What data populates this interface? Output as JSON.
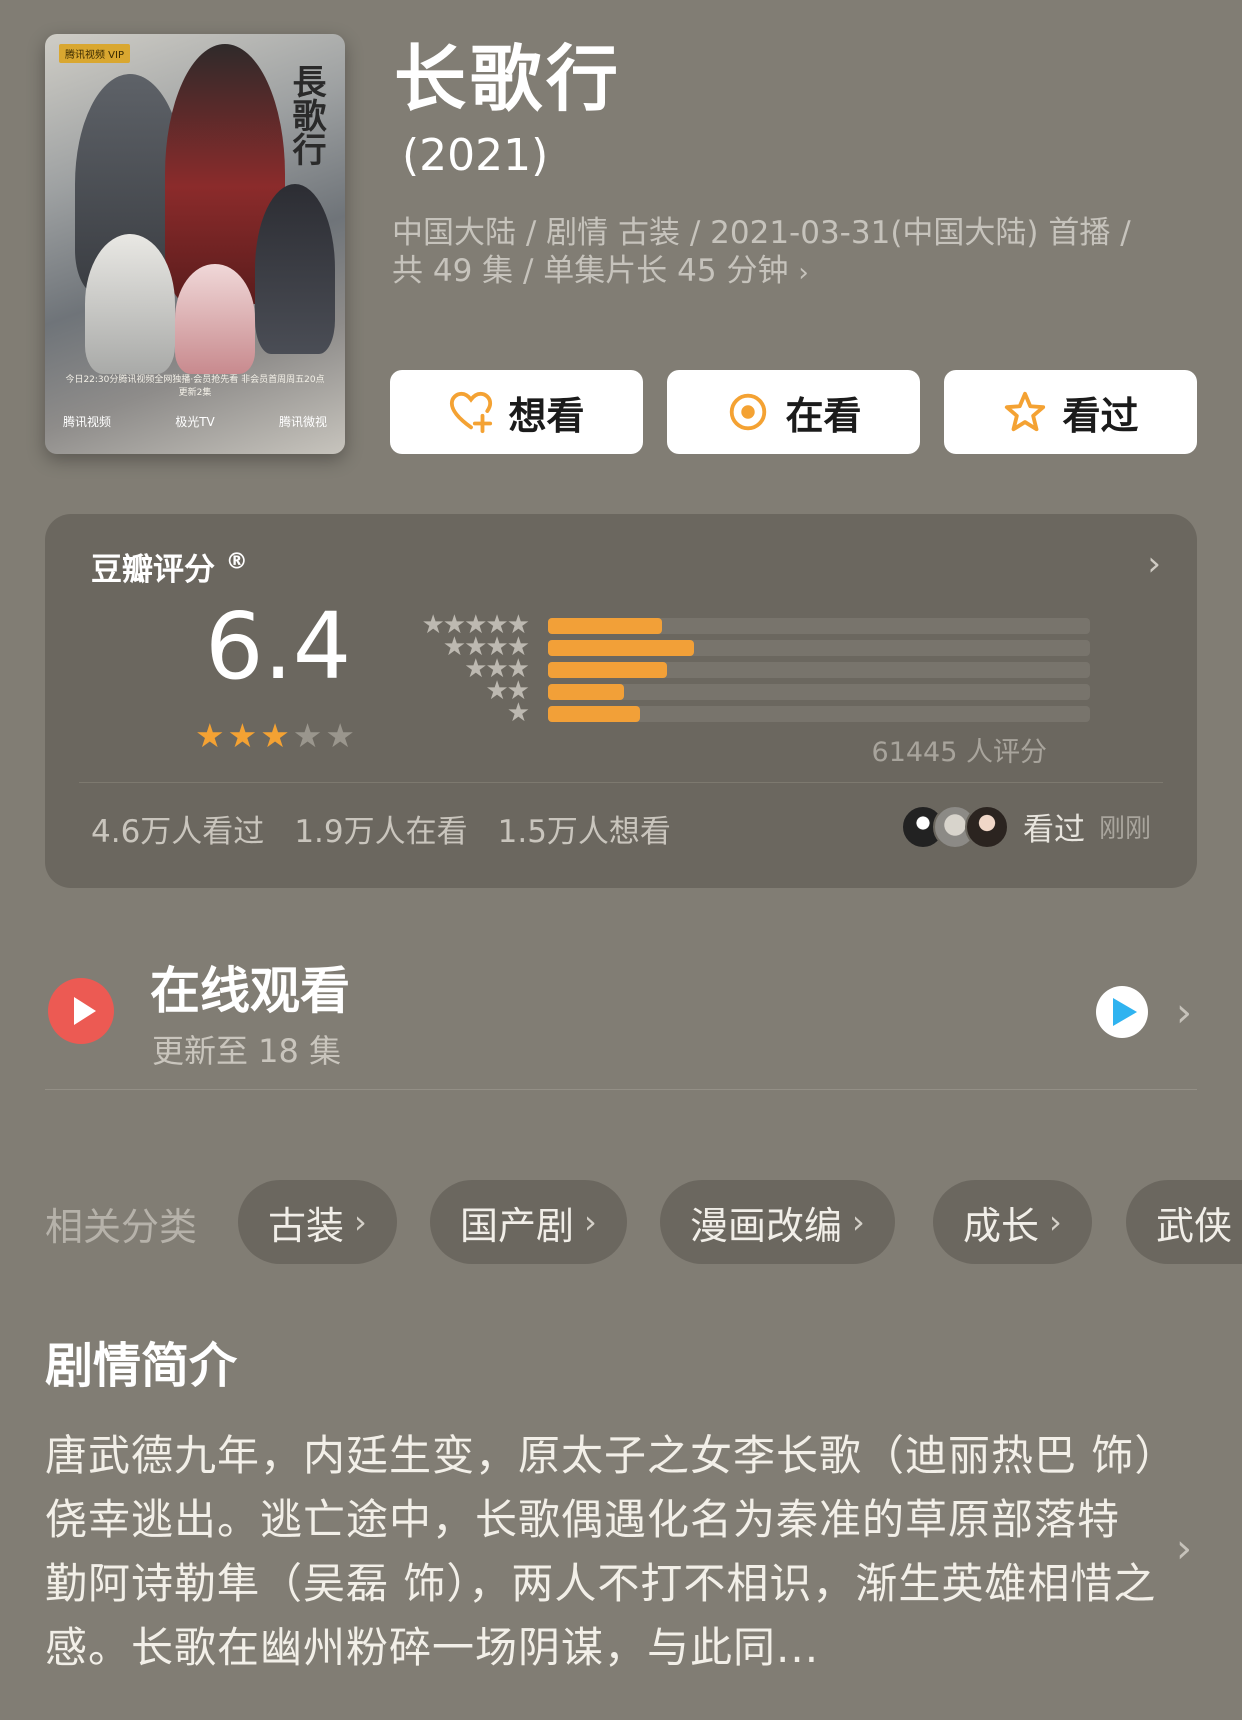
{
  "title": "长歌行",
  "year": "(2021)",
  "meta": {
    "line1": "中国大陆 / 剧情 古装 / 2021-03-31(中国大陆) 首播 /",
    "line2": "共 49 集 / 单集片长 45 分钟",
    "chevron": "›"
  },
  "poster": {
    "badge": "腾讯视频 VIP",
    "calligraphy": "長歌行",
    "tagline": "今日22:30分腾讯视频全网独播·会员抢先看 非会员首周周五20点更新2集",
    "platforms": [
      "腾讯视频",
      "极光TV",
      "腾讯微视"
    ]
  },
  "actions": {
    "want": "想看",
    "watching": "在看",
    "watched": "看过"
  },
  "rating": {
    "label": "豆瓣评分",
    "registered": "®",
    "arrow": "›",
    "score": "6.4",
    "stars": 3,
    "max_stars": 5,
    "distribution": [
      {
        "stars": "★★★★★",
        "fraction": 0.21
      },
      {
        "stars": "★★★★",
        "fraction": 0.27
      },
      {
        "stars": "★★★",
        "fraction": 0.22
      },
      {
        "stars": "★★",
        "fraction": 0.14
      },
      {
        "stars": "★",
        "fraction": 0.17
      }
    ],
    "count": "61445 人评分",
    "stats": [
      "4.6万人看过",
      "1.9万人在看",
      "1.5万人想看"
    ],
    "friend_action": "看过",
    "friend_time": "刚刚"
  },
  "online": {
    "title": "在线观看",
    "subtitle": "更新至 18 集",
    "arrow": "›"
  },
  "categories": {
    "label": "相关分类",
    "chevron": "›",
    "items": [
      "古装",
      "国产剧",
      "漫画改编",
      "成长",
      "武侠"
    ]
  },
  "synopsis": {
    "title": "剧情简介",
    "body": "唐武德九年，内廷生变，原太子之女李长歌（迪丽热巴 饰）侥幸逃出。逃亡途中，长歌偶遇化名为秦准的草原部落特勤阿诗勒隼（吴磊 饰），两人不打不相识，渐生英雄相惜之感。长歌在幽州粉碎一场阴谋，与此同...",
    "arrow": "›"
  },
  "colors": {
    "background": "#817d74",
    "card": "#6b675f",
    "accent_star": "#f4a233",
    "bar": "#f2a038",
    "play": "#ec5a53"
  }
}
